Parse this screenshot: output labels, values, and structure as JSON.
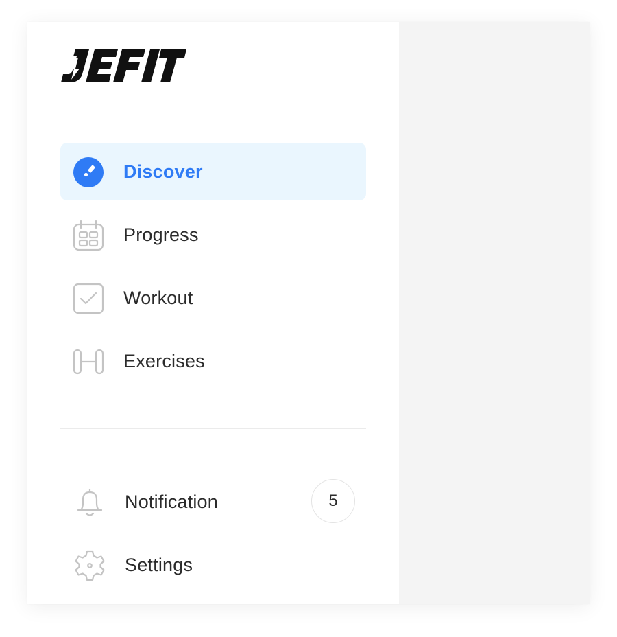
{
  "brand": {
    "name": "JEFIT"
  },
  "nav": {
    "items": [
      {
        "label": "Discover",
        "icon": "compass-icon",
        "active": true
      },
      {
        "label": "Progress",
        "icon": "calendar-icon",
        "active": false
      },
      {
        "label": "Workout",
        "icon": "checkbox-icon",
        "active": false
      },
      {
        "label": "Exercises",
        "icon": "dumbbell-icon",
        "active": false
      }
    ]
  },
  "bottom": {
    "notification": {
      "label": "Notification",
      "icon": "bell-icon",
      "count": "5"
    },
    "settings": {
      "label": "Settings",
      "icon": "gear-icon"
    }
  },
  "colors": {
    "accent": "#2f7bf5",
    "active_bg": "#eaf6fe",
    "icon_gray": "#c4c4c4",
    "content_bg": "#f4f4f4"
  }
}
